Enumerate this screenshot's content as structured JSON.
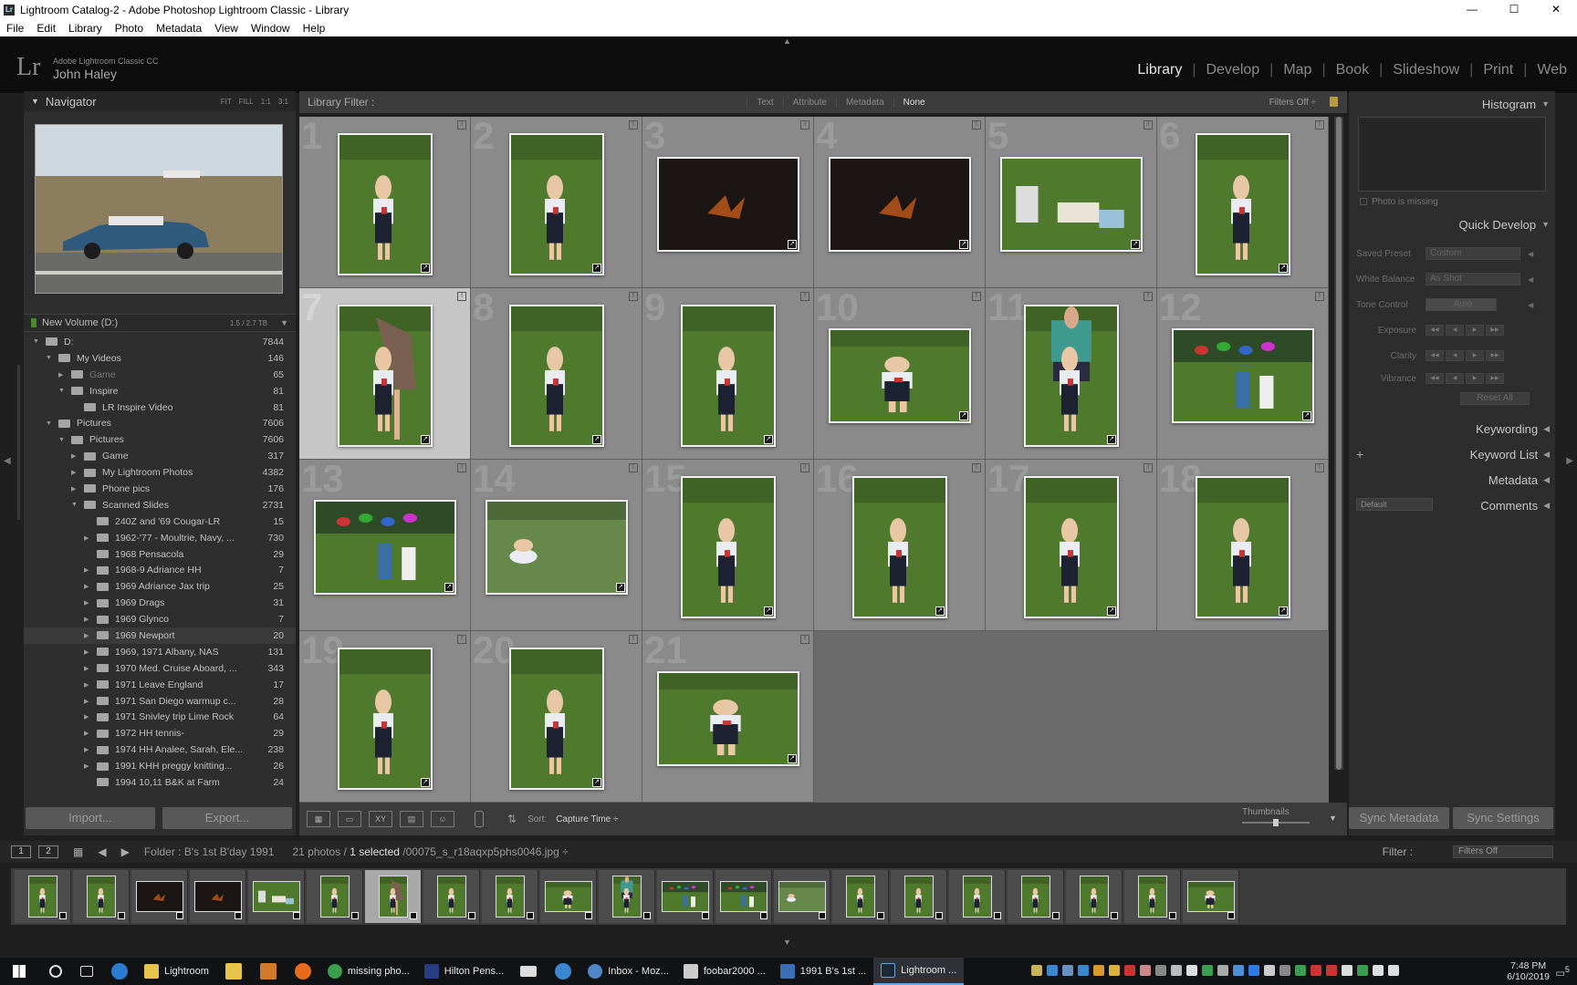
{
  "window": {
    "title": "Lightroom Catalog-2 - Adobe Photoshop Lightroom Classic - Library",
    "min": "—",
    "max": "☐",
    "close": "✕"
  },
  "menu": [
    "File",
    "Edit",
    "Library",
    "Photo",
    "Metadata",
    "View",
    "Window",
    "Help"
  ],
  "identity": {
    "logo": "Lr",
    "product": "Adobe Lightroom Classic CC",
    "user": "John Haley"
  },
  "modules": [
    "Library",
    "Develop",
    "Map",
    "Book",
    "Slideshow",
    "Print",
    "Web"
  ],
  "active_module": "Library",
  "navigator": {
    "title": "Navigator",
    "options": [
      "FIT",
      "FILL",
      "1:1",
      "3:1"
    ]
  },
  "volume": {
    "name": "New Volume (D:)",
    "space": "1.5 / 2.7 TB"
  },
  "folders": [
    {
      "name": "D:",
      "count": "7844",
      "level": 0,
      "open": true
    },
    {
      "name": "My Videos",
      "count": "146",
      "level": 1,
      "open": true
    },
    {
      "name": "Game",
      "count": "65",
      "level": 2,
      "open": false,
      "dim": true
    },
    {
      "name": "Inspire",
      "count": "81",
      "level": 2,
      "open": true
    },
    {
      "name": "LR Inspire Video",
      "count": "81",
      "level": 3,
      "open": null
    },
    {
      "name": "Pictures",
      "count": "7606",
      "level": 1,
      "open": true
    },
    {
      "name": "Pictures",
      "count": "7606",
      "level": 2,
      "open": true
    },
    {
      "name": "Game",
      "count": "317",
      "level": 3,
      "open": false
    },
    {
      "name": "My Lightroom Photos",
      "count": "4382",
      "level": 3,
      "open": false
    },
    {
      "name": "Phone pics",
      "count": "176",
      "level": 3,
      "open": false
    },
    {
      "name": "Scanned Slides",
      "count": "2731",
      "level": 3,
      "open": true
    },
    {
      "name": "240Z and '69 Cougar-LR",
      "count": "15",
      "level": 4,
      "open": null
    },
    {
      "name": "1962-'77 - Moultrie, Navy, ...",
      "count": "730",
      "level": 4,
      "open": false
    },
    {
      "name": "1968 Pensacola",
      "count": "29",
      "level": 4,
      "open": null
    },
    {
      "name": "1968-9 Adriance HH",
      "count": "7",
      "level": 4,
      "open": false
    },
    {
      "name": "1969 Adriance Jax trip",
      "count": "25",
      "level": 4,
      "open": false
    },
    {
      "name": "1969 Drags",
      "count": "31",
      "level": 4,
      "open": false
    },
    {
      "name": "1969 Glynco",
      "count": "7",
      "level": 4,
      "open": false
    },
    {
      "name": "1969 Newport",
      "count": "20",
      "level": 4,
      "open": false,
      "hl": true
    },
    {
      "name": "1969, 1971 Albany, NAS",
      "count": "131",
      "level": 4,
      "open": false
    },
    {
      "name": "1970 Med. Cruise Aboard, ...",
      "count": "343",
      "level": 4,
      "open": false
    },
    {
      "name": "1971 Leave England",
      "count": "17",
      "level": 4,
      "open": false
    },
    {
      "name": "1971 San Diego warmup c...",
      "count": "28",
      "level": 4,
      "open": false
    },
    {
      "name": "1971 Snivley trip Lime Rock",
      "count": "64",
      "level": 4,
      "open": false
    },
    {
      "name": "1972 HH tennis-",
      "count": "29",
      "level": 4,
      "open": false
    },
    {
      "name": "1974 HH Analee, Sarah, Ele...",
      "count": "238",
      "level": 4,
      "open": false
    },
    {
      "name": "1991 KHH  preggy knitting...",
      "count": "26",
      "level": 4,
      "open": false
    },
    {
      "name": "1994 10,11 B&K at Farm",
      "count": "24",
      "level": 4,
      "open": null
    }
  ],
  "left_buttons": {
    "import": "Import...",
    "export": "Export..."
  },
  "filter_bar": {
    "title": "Library Filter :",
    "tabs": [
      "Text",
      "Attribute",
      "Metadata",
      "None"
    ],
    "active": "None",
    "preset": "Filters Off ÷"
  },
  "grid": {
    "selected": 7,
    "items": [
      {
        "n": "1",
        "o": "p",
        "s": "kid"
      },
      {
        "n": "2",
        "o": "p",
        "s": "kid"
      },
      {
        "n": "3",
        "o": "l",
        "s": "dark"
      },
      {
        "n": "4",
        "o": "l",
        "s": "dark"
      },
      {
        "n": "5",
        "o": "l",
        "s": "gifts"
      },
      {
        "n": "6",
        "o": "p",
        "s": "kid"
      },
      {
        "n": "7",
        "o": "p",
        "s": "mom"
      },
      {
        "n": "8",
        "o": "p",
        "s": "kid"
      },
      {
        "n": "9",
        "o": "p",
        "s": "kid"
      },
      {
        "n": "10",
        "o": "l",
        "s": "kid"
      },
      {
        "n": "11",
        "o": "p",
        "s": "dad"
      },
      {
        "n": "12",
        "o": "l",
        "s": "party"
      },
      {
        "n": "13",
        "o": "l",
        "s": "party"
      },
      {
        "n": "14",
        "o": "l",
        "s": "lawn"
      },
      {
        "n": "15",
        "o": "p",
        "s": "kid"
      },
      {
        "n": "16",
        "o": "p",
        "s": "kid"
      },
      {
        "n": "17",
        "o": "p",
        "s": "kid"
      },
      {
        "n": "18",
        "o": "p",
        "s": "kid"
      },
      {
        "n": "19",
        "o": "p",
        "s": "kid"
      },
      {
        "n": "20",
        "o": "p",
        "s": "kid"
      },
      {
        "n": "21",
        "o": "l",
        "s": "kid"
      }
    ]
  },
  "toolbar": {
    "views": [
      "▦",
      "▭",
      "XY",
      "▤",
      "☺"
    ],
    "sort_label": "Sort:",
    "sort_value": "Capture Time ÷",
    "thumbnails_label": "Thumbnails"
  },
  "right_panel": {
    "histogram": "Histogram",
    "photo_missing": "Photo is missing",
    "quick_develop": "Quick Develop",
    "qd_rows": [
      {
        "label": "Saved Preset",
        "value": "Custom"
      },
      {
        "label": "White Balance",
        "value": "As Shot"
      },
      {
        "label": "Tone Control",
        "value": "Auto"
      },
      {
        "label": "Exposure",
        "value": ""
      },
      {
        "label": "Clarity",
        "value": ""
      },
      {
        "label": "Vibrance",
        "value": ""
      }
    ],
    "reset_all": "Reset All",
    "keywording": "Keywording",
    "keyword_list": "Keyword List",
    "metadata": "Metadata",
    "metadata_preset": "Default",
    "comments": "Comments",
    "sync_metadata": "Sync Metadata",
    "sync_settings": "Sync Settings"
  },
  "filmstrip_bar": {
    "page1": "1",
    "page2": "2",
    "folder": "Folder : B's 1st B'day 1991",
    "count_prefix": "21 photos /",
    "count_selected": "1 selected",
    "file": "/00075_s_r18aqxp5phs0046.jpg ÷",
    "filter_label": "Filter :",
    "filter_value": "Filters Off"
  },
  "taskbar": {
    "items": [
      "Lightroom",
      "missing pho...",
      "Hilton Pens...",
      "Inbox - Moz...",
      "foobar2000 ...",
      "1991 B's 1st ...",
      "Lightroom ..."
    ],
    "active": "Lightroom ...",
    "time": "7:48 PM",
    "date": "6/10/2019",
    "notif": "5"
  },
  "colors": {
    "grass": "#4f7a2e",
    "shirt": "#e9edf2",
    "overall": "#1d2233",
    "dark": "#1b1513",
    "ember": "#c45a1c"
  }
}
